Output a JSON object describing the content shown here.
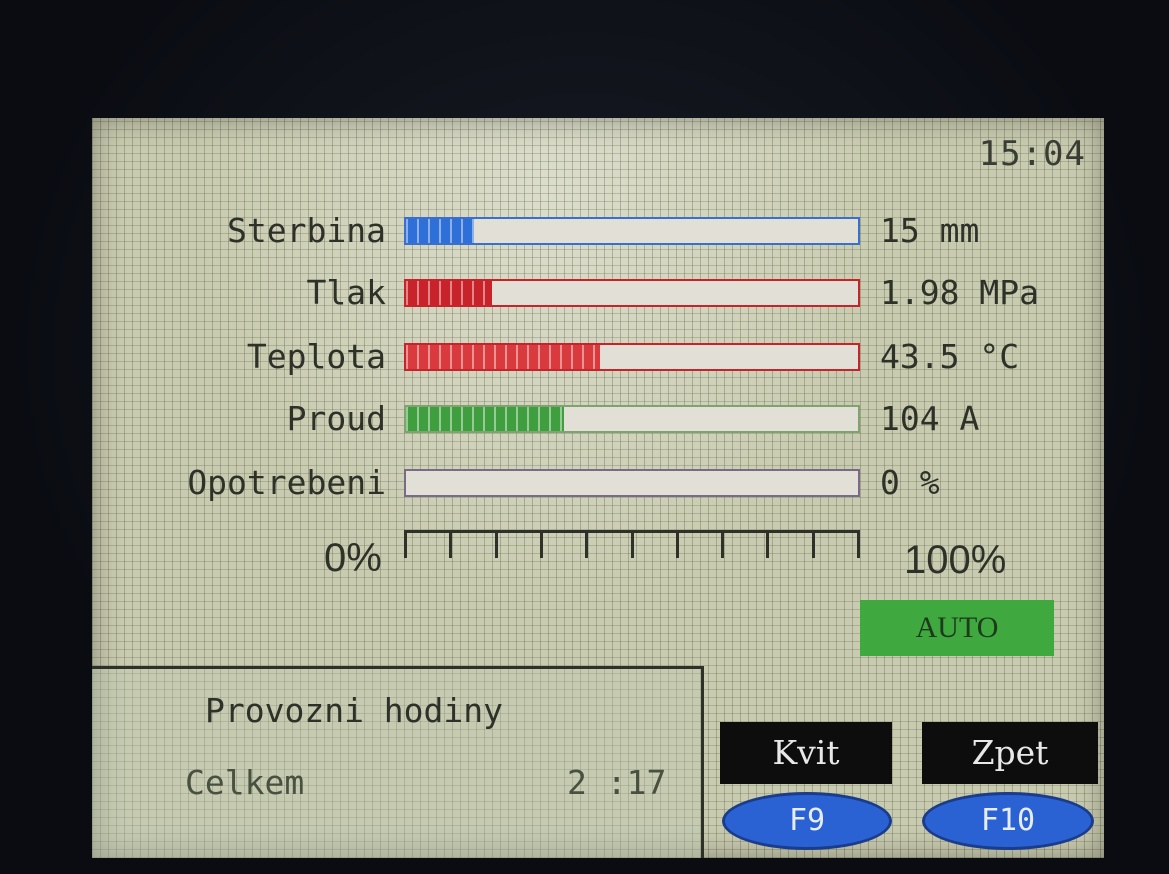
{
  "clock": "15:04",
  "rows": [
    {
      "label": "Sterbina",
      "value": "15 mm",
      "fill": 0.15,
      "color": "#2f6fd8",
      "border": "#3a6fcf"
    },
    {
      "label": "Tlak",
      "value": "1.98 MPa",
      "fill": 0.19,
      "color": "#c8232b",
      "border": "#c8232b"
    },
    {
      "label": "Teplota",
      "value": "43.5 °C",
      "fill": 0.43,
      "color": "#d83a3e",
      "border": "#c8232b"
    },
    {
      "label": "Proud",
      "value": "104 A",
      "fill": 0.35,
      "color": "#3f9f3f",
      "border": "#7ea36e"
    },
    {
      "label": "Opotrebeni",
      "value": "0 %",
      "fill": 0.0,
      "color": "#999999",
      "border": "#7a6a8a"
    }
  ],
  "scale": {
    "min": "0%",
    "max": "100%",
    "ticks": 11
  },
  "mode_badge": "AUTO",
  "hours": {
    "title": "Provozni hodiny",
    "label": "Celkem",
    "value": "2 :17"
  },
  "fkeys": [
    {
      "label": "Kvit",
      "key": "F9"
    },
    {
      "label": "Zpet",
      "key": "F10"
    }
  ]
}
